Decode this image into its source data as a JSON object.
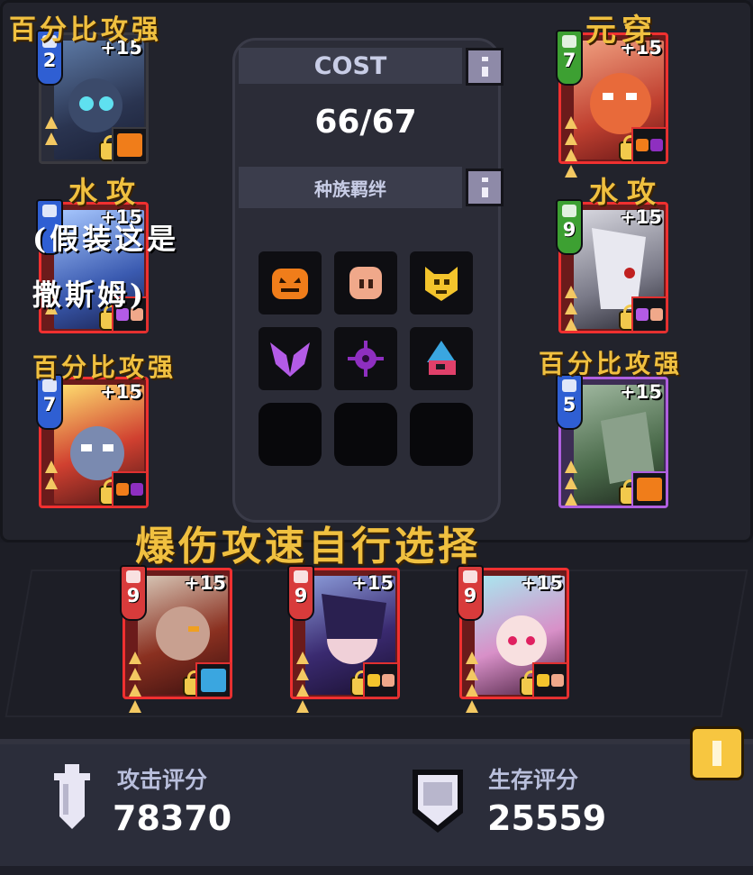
{
  "center": {
    "cost_label": "COST",
    "cost_value": "66/67",
    "bond_label": "种族羁绊",
    "bond_icons": [
      {
        "name": "pumpkin-race-icon",
        "color": "#f07d1a"
      },
      {
        "name": "beast-race-icon",
        "color": "#f0a88a"
      },
      {
        "name": "demon-race-icon",
        "color": "#f3c42c"
      },
      {
        "name": "winged-race-icon",
        "color": "#b35be6"
      },
      {
        "name": "virus-race-icon",
        "color": "#8e2fc0"
      },
      {
        "name": "ninja-race-icon",
        "color": "#3aa6e0"
      }
    ]
  },
  "heroes": [
    {
      "id": "hero-1",
      "cost": "2",
      "plus": "+15",
      "tag": "blue",
      "frame": "blue"
    },
    {
      "id": "hero-2",
      "cost": "7",
      "plus": "+15",
      "tag": "green",
      "frame": "red"
    },
    {
      "id": "hero-3",
      "cost": "",
      "plus": "+15",
      "tag": "blue",
      "frame": "red"
    },
    {
      "id": "hero-4",
      "cost": "9",
      "plus": "+15",
      "tag": "green",
      "frame": "red"
    },
    {
      "id": "hero-5",
      "cost": "7",
      "plus": "+15",
      "tag": "blue",
      "frame": "red"
    },
    {
      "id": "hero-6",
      "cost": "5",
      "plus": "+15",
      "tag": "blue",
      "frame": "purple"
    },
    {
      "id": "hero-7",
      "cost": "9",
      "plus": "+15",
      "tag": "red",
      "frame": "red"
    },
    {
      "id": "hero-8",
      "cost": "9",
      "plus": "+15",
      "tag": "red",
      "frame": "red"
    },
    {
      "id": "hero-9",
      "cost": "9",
      "plus": "+15",
      "tag": "red",
      "frame": "red"
    }
  ],
  "annotations": {
    "top_left": "百分比攻强",
    "top_right": "元穿",
    "mid_left": "水攻",
    "mid_left_note_1": "(假装这是",
    "mid_left_note_2": "撒斯姆)",
    "mid_right": "水攻",
    "lower_left": "百分比攻强",
    "lower_right": "百分比攻强",
    "bottom_row": "爆伤攻速自行选择"
  },
  "scores": {
    "attack_label": "攻击评分",
    "attack_value": "78370",
    "survival_label": "生存评分",
    "survival_value": "25559"
  },
  "colors": {
    "gold": "#f0c040",
    "frame_red": "#f03030",
    "frame_purple": "#b05fe0"
  }
}
